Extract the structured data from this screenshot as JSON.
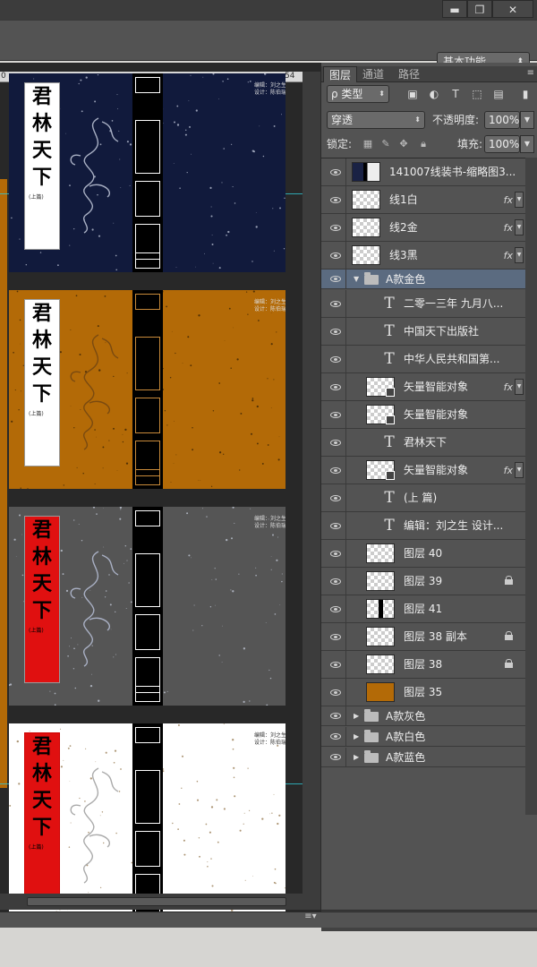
{
  "window": {
    "minimize_glyph": "▬",
    "maximize_glyph": "❐",
    "close_glyph": "✕"
  },
  "toolbar": {
    "workspace": "基本功能"
  },
  "ruler": {
    "left_tick": "0",
    "right_tick": "54"
  },
  "canvas": {
    "books": [
      {
        "variant": "blue",
        "bg": "#111a3c",
        "title_chars": [
          "君",
          "林",
          "天",
          "下"
        ],
        "sub": "(上篇)",
        "box_bg": "#ffffff",
        "title_color": "#000000",
        "spine_band": "#ffffff",
        "stitch": "#ffffff"
      },
      {
        "variant": "gold",
        "bg": "#b36a07",
        "title_chars": [
          "君",
          "林",
          "天",
          "下"
        ],
        "sub": "(上篇)",
        "box_bg": "#ffffff",
        "title_color": "#000000",
        "spine_band": "#c88a3a",
        "stitch": "#c88a3a"
      },
      {
        "variant": "gray",
        "bg": "#555555",
        "title_chars": [
          "君",
          "林",
          "天",
          "下"
        ],
        "sub": "(上篇)",
        "box_bg": "#e01010",
        "title_color": "#000000",
        "spine_band": "#ffffff",
        "stitch": "#ffffff"
      },
      {
        "variant": "white",
        "bg": "#ffffff",
        "title_chars": [
          "君",
          "林",
          "天",
          "下"
        ],
        "sub": "(上篇)",
        "box_bg": "#e01010",
        "title_color": "#000000",
        "spine_band": "#ffffff",
        "stitch": "#000000"
      }
    ],
    "corner_text": "编辑：刘之生\n设计：陈伯瑞"
  },
  "panel": {
    "tabs": {
      "layers": "图层",
      "channels": "通道",
      "paths": "路径"
    },
    "filter": {
      "kind": "ρ 类型"
    },
    "blend": {
      "mode": "穿透",
      "opacity_label": "不透明度:",
      "opacity": "100%"
    },
    "lock": {
      "label": "锁定:",
      "fill_label": "填充:",
      "fill": "100%"
    },
    "layers": [
      {
        "type": "image",
        "name": "141007线装书-缩略图3...",
        "fx": false,
        "lock": false
      },
      {
        "type": "pixel",
        "name": "线1白",
        "fx": true,
        "lock": false
      },
      {
        "type": "pixel",
        "name": "线2金",
        "fx": true,
        "lock": false
      },
      {
        "type": "pixel",
        "name": "线3黑",
        "fx": true,
        "lock": false
      },
      {
        "type": "group-open",
        "name": "A款金色",
        "selected": true
      },
      {
        "type": "text",
        "name": "二零一三年 九月八..."
      },
      {
        "type": "text",
        "name": "中国天下出版社"
      },
      {
        "type": "text",
        "name": "中华人民共和国第..."
      },
      {
        "type": "smart",
        "name": "矢量智能对象",
        "fx": true
      },
      {
        "type": "smart",
        "name": "矢量智能对象",
        "fx": false
      },
      {
        "type": "text",
        "name": "君林天下"
      },
      {
        "type": "smart",
        "name": "矢量智能对象",
        "fx": true
      },
      {
        "type": "text",
        "name": "(上 篇)"
      },
      {
        "type": "text",
        "name": "编辑：刘之生 设计..."
      },
      {
        "type": "pixel",
        "name": "图层 40",
        "lock": false
      },
      {
        "type": "pixel",
        "name": "图层 39",
        "lock": true
      },
      {
        "type": "spine",
        "name": "图层 41",
        "lock": false
      },
      {
        "type": "pixel",
        "name": "图层 38 副本",
        "lock": true
      },
      {
        "type": "pixel",
        "name": "图层 38",
        "lock": true
      },
      {
        "type": "fill",
        "name": "图层 35",
        "color": "#b36a07",
        "lock": false
      },
      {
        "type": "group",
        "name": "A款灰色"
      },
      {
        "type": "group",
        "name": "A款白色"
      },
      {
        "type": "group",
        "name": "A款蓝色"
      }
    ],
    "fx_label": "fx",
    "text_glyph": "T",
    "bottom_icons": [
      "link-icon",
      "fx-icon",
      "mask-icon",
      "adjustment-icon",
      "folder-icon",
      "new-layer-icon",
      "trash-icon"
    ]
  }
}
